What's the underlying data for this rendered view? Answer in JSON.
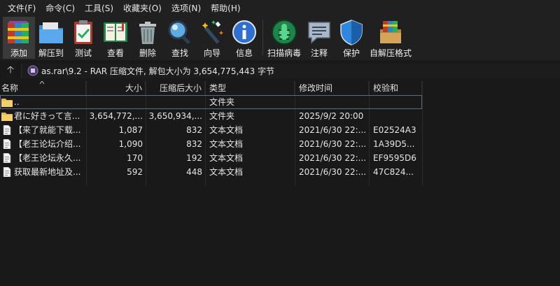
{
  "menubar": {
    "items": [
      "文件(F)",
      "命令(C)",
      "工具(S)",
      "收藏夹(O)",
      "选项(N)",
      "帮助(H)"
    ]
  },
  "toolbar": {
    "buttons": [
      {
        "label": "添加",
        "icon": "books-add-icon"
      },
      {
        "label": "解压到",
        "icon": "folder-extract-icon"
      },
      {
        "label": "测试",
        "icon": "clipboard-test-icon"
      },
      {
        "label": "查看",
        "icon": "book-view-icon"
      },
      {
        "label": "删除",
        "icon": "trash-icon"
      },
      {
        "label": "查找",
        "icon": "magnifier-icon"
      },
      {
        "label": "向导",
        "icon": "magic-wand-icon"
      },
      {
        "label": "信息",
        "icon": "info-icon"
      },
      {
        "label": "扫描病毒",
        "icon": "bug-scan-icon"
      },
      {
        "label": "注释",
        "icon": "comment-icon"
      },
      {
        "label": "保护",
        "icon": "shield-icon"
      },
      {
        "label": "自解压格式",
        "icon": "sfx-box-icon"
      }
    ]
  },
  "pathbar": {
    "text": "as.rar\\9.2 - RAR 压缩文件, 解包大小为 3,654,775,443 字节",
    "up_glyph": "🡡"
  },
  "columns": {
    "name": "名称",
    "size": "大小",
    "packed": "压缩后大小",
    "type": "类型",
    "modified": "修改时间",
    "crc": "校验和"
  },
  "files": [
    {
      "name": "..",
      "size": "",
      "packed": "",
      "type": "文件夹",
      "modified": "",
      "crc": "",
      "kind": "folder",
      "selected": true
    },
    {
      "name": "君に好きって言...",
      "size": "3,654,772,...",
      "packed": "3,650,934,...",
      "type": "文件夹",
      "modified": "2025/9/2 20:00",
      "crc": "",
      "kind": "folder",
      "selected": false
    },
    {
      "name": "【来了就能下载...",
      "size": "1,087",
      "packed": "832",
      "type": "文本文档",
      "modified": "2021/6/30 22:...",
      "crc": "E02524A3",
      "kind": "file",
      "selected": false
    },
    {
      "name": "【老王论坛介绍...",
      "size": "1,090",
      "packed": "832",
      "type": "文本文档",
      "modified": "2021/6/30 22:...",
      "crc": "1A39D5...",
      "kind": "file",
      "selected": false
    },
    {
      "name": "【老王论坛永久...",
      "size": "170",
      "packed": "192",
      "type": "文本文档",
      "modified": "2021/6/30 22:...",
      "crc": "EF9595D6",
      "kind": "file",
      "selected": false
    },
    {
      "name": "获取最新地址及...",
      "size": "592",
      "packed": "448",
      "type": "文本文档",
      "modified": "2021/6/30 22:...",
      "crc": "47C824...",
      "kind": "file",
      "selected": false
    }
  ]
}
